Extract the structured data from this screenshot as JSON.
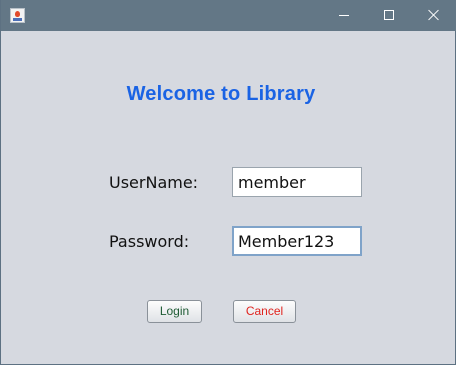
{
  "window": {
    "title": "",
    "icon": "java-cup-icon",
    "controls": {
      "minimize": "minimize-icon",
      "maximize": "maximize-icon",
      "close": "close-icon"
    }
  },
  "form": {
    "heading": "Welcome to Library",
    "username_label": "UserName:",
    "username_value": "member",
    "password_label": "Password:",
    "password_value": "Member123",
    "login_label": "Login",
    "cancel_label": "Cancel"
  },
  "colors": {
    "heading": "#1a63e4",
    "titlebar": "#637786",
    "background": "#d6d9e0",
    "login_text": "#1f5c35",
    "cancel_text": "#e0241f"
  }
}
